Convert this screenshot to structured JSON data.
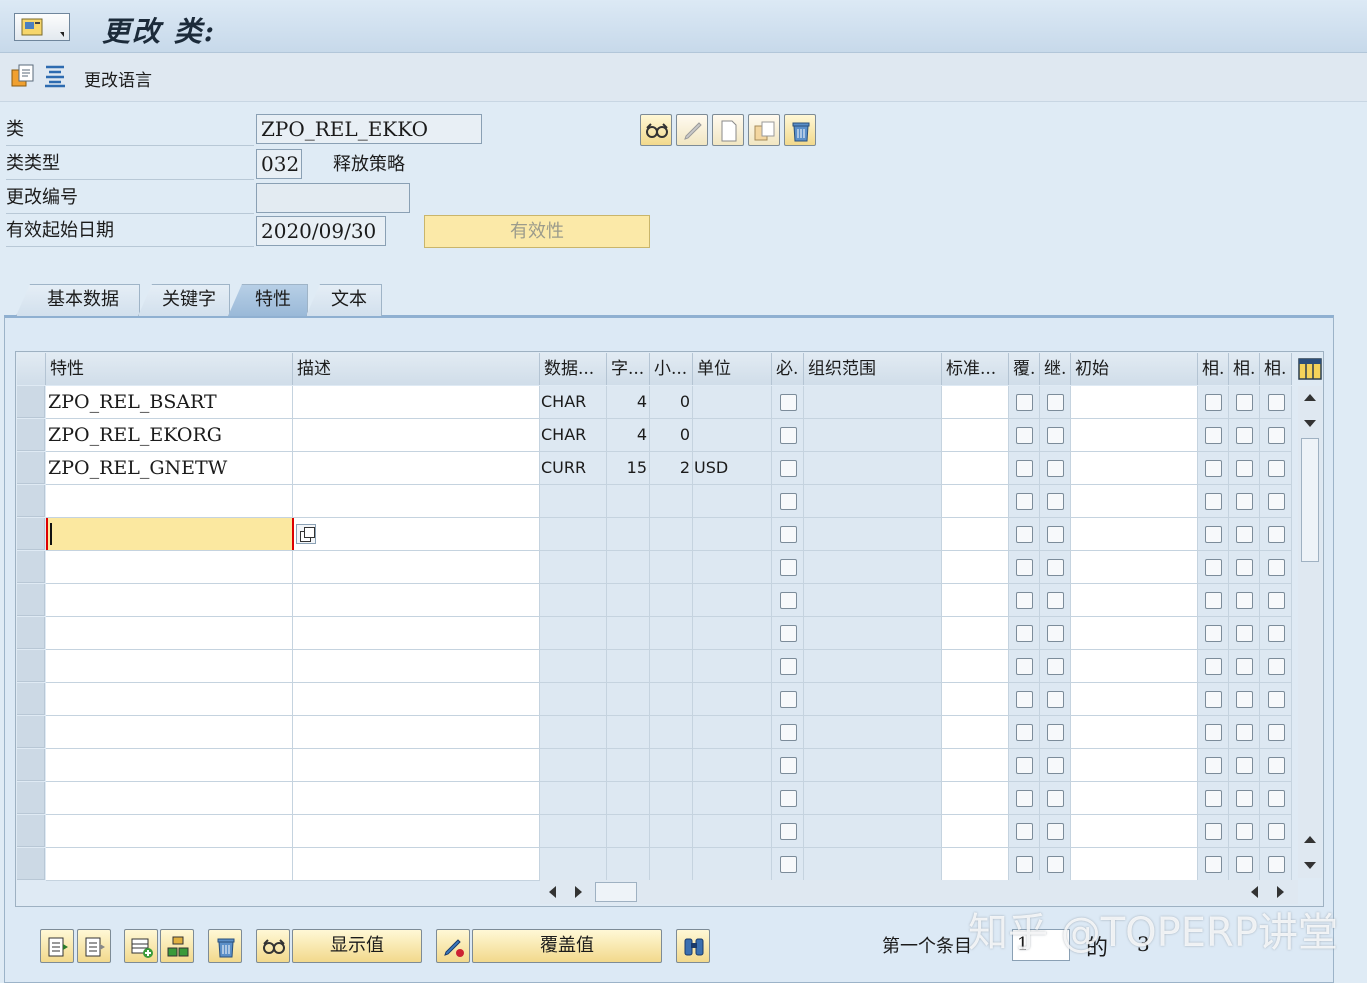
{
  "window": {
    "title": "更改 类:"
  },
  "toolbar": {
    "change_language_label": "更改语言",
    "icons": [
      "copy-icon",
      "align-icon"
    ]
  },
  "header": {
    "class_label": "类",
    "class_value": "ZPO_REL_EKKO",
    "class_type_label": "类类型",
    "class_type_value": "032",
    "class_type_text": "释放策略",
    "change_number_label": "更改编号",
    "change_number_value": "",
    "valid_from_label": "有效起始日期",
    "valid_from_value": "2020/09/30",
    "validity_button": "有效性",
    "side_buttons": [
      "display-icon",
      "edit-icon",
      "create-icon",
      "copy-icon",
      "delete-icon"
    ]
  },
  "tabs": [
    {
      "label": "基本数据",
      "active": false
    },
    {
      "label": "关键字",
      "active": false
    },
    {
      "label": "特性",
      "active": true
    },
    {
      "label": "文本",
      "active": false
    }
  ],
  "table": {
    "columns": [
      "特性",
      "描述",
      "数据...",
      "字...",
      "小...",
      "单位",
      "必.",
      "组织范围",
      "标准...",
      "覆.",
      "继.",
      "初始",
      "相.",
      "相.",
      "相."
    ],
    "rows": [
      {
        "characteristic": "ZPO_REL_BSART",
        "description": "",
        "data_type": "CHAR",
        "chars": "4",
        "decimals": "0",
        "unit": ""
      },
      {
        "characteristic": "ZPO_REL_EKORG",
        "description": "",
        "data_type": "CHAR",
        "chars": "4",
        "decimals": "0",
        "unit": ""
      },
      {
        "characteristic": "ZPO_REL_GNETW",
        "description": "",
        "data_type": "CURR",
        "chars": "15",
        "decimals": "2",
        "unit": "USD"
      }
    ],
    "visible_row_count": 15
  },
  "footer": {
    "display_values_button": "显示值",
    "overwrite_values_button": "覆盖值",
    "first_entry_label": "第一个条目",
    "first_entry_value": "1",
    "of_label": "的",
    "total_entries": "3"
  },
  "watermark": "知乎 @TOPERP讲堂"
}
